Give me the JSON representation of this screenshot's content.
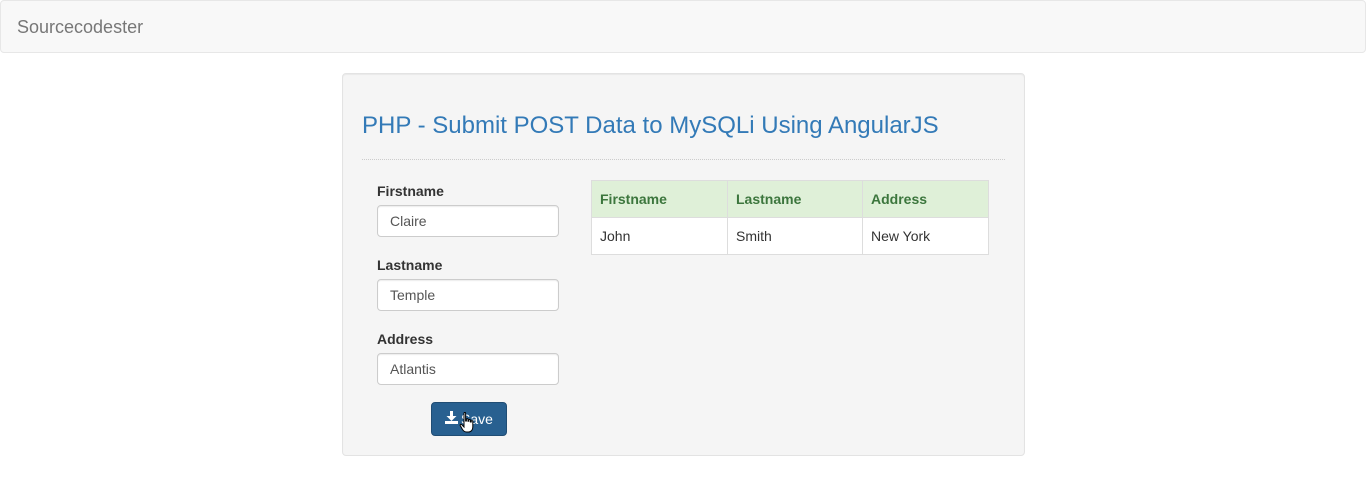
{
  "navbar": {
    "brand": "Sourcecodester"
  },
  "panel": {
    "title": "PHP - Submit POST Data to MySQLi Using AngularJS"
  },
  "form": {
    "firstname": {
      "label": "Firstname",
      "value": "Claire"
    },
    "lastname": {
      "label": "Lastname",
      "value": "Temple"
    },
    "address": {
      "label": "Address",
      "value": "Atlantis"
    },
    "save_button": {
      "label": "Save",
      "icon": "download-icon"
    }
  },
  "table": {
    "headers": [
      "Firstname",
      "Lastname",
      "Address"
    ],
    "rows": [
      [
        "John",
        "Smith",
        "New York"
      ]
    ]
  },
  "colors": {
    "link_blue": "#337ab7",
    "button_blue": "#286090",
    "header_green_bg": "#dff0d8",
    "header_green_text": "#3c763d"
  }
}
